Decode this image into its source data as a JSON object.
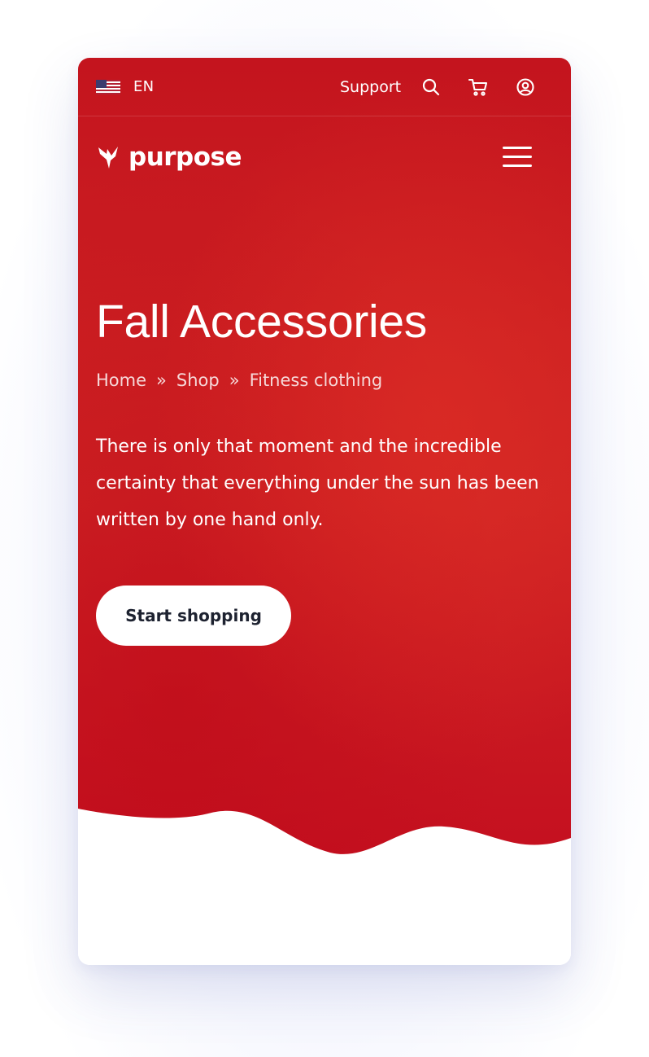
{
  "topbar": {
    "language": "EN",
    "flag_icon": "us-flag-icon",
    "support_label": "Support",
    "icons": [
      "search-icon",
      "cart-icon",
      "user-circle-icon"
    ]
  },
  "brand": {
    "name": "purpose",
    "logo_icon": "bird-logo-icon"
  },
  "nav": {
    "menu_icon": "hamburger-menu-icon"
  },
  "hero": {
    "title": "Fall Accessories",
    "breadcrumb": [
      {
        "label": "Home"
      },
      {
        "label": "Shop"
      },
      {
        "label": "Fitness clothing"
      }
    ],
    "breadcrumb_separator": "»",
    "lead": "There is only that moment and the incredible certainty that everything under the sun has been written by one hand only.",
    "cta_label": "Start shopping"
  },
  "colors": {
    "hero_red": "#c8161f",
    "button_bg": "#ffffff",
    "button_text": "#1d2230",
    "text_light": "#ffffff"
  }
}
